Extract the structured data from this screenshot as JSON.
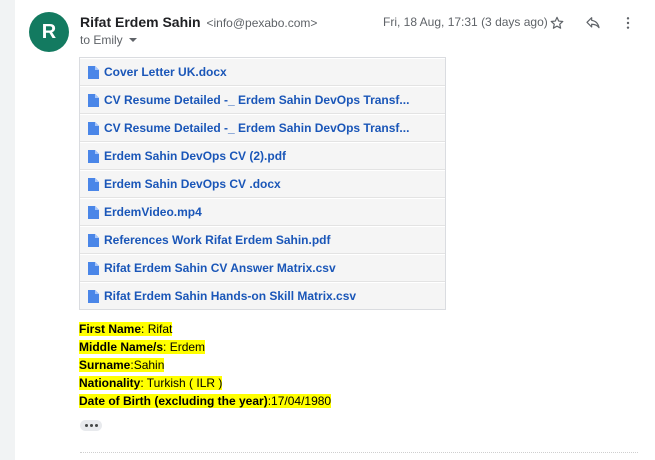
{
  "email": {
    "avatar_letter": "R",
    "sender_name": "Rifat Erdem Sahin",
    "sender_email": "<info@pexabo.com>",
    "date": "Fri, 18 Aug, 17:31 (3 days ago)",
    "to_line": "to Emily"
  },
  "attachments": [
    "Cover Letter UK.docx",
    "CV Resume Detailed -_ Erdem Sahin DevOps Transf...",
    "CV Resume Detailed -_ Erdem Sahin DevOps Transf...",
    "Erdem Sahin DevOps CV (2).pdf",
    "Erdem Sahin DevOps CV .docx",
    "ErdemVideo.mp4",
    "References Work Rifat Erdem Sahin.pdf",
    "Rifat Erdem Sahin CV Answer Matrix.csv",
    "Rifat Erdem Sahin Hands-on Skill Matrix.csv"
  ],
  "fields": [
    {
      "label": "First Name",
      "value": ": Rifat"
    },
    {
      "label": "Middle Name/s",
      "value": ": Erdem"
    },
    {
      "label": "Surname",
      "value": ":Sahin"
    },
    {
      "label": "Nationality",
      "value": ": Turkish ( ILR )"
    },
    {
      "label": "Date of Birth (excluding the year)",
      "value": ":17/04/1980"
    }
  ],
  "colors": {
    "avatar": "#137a60",
    "link": "#1a56b8",
    "highlight": "#ffff00"
  },
  "icons": {
    "star": "star-icon",
    "reply": "reply-icon",
    "more": "more-vert-icon",
    "file": "file-icon"
  }
}
